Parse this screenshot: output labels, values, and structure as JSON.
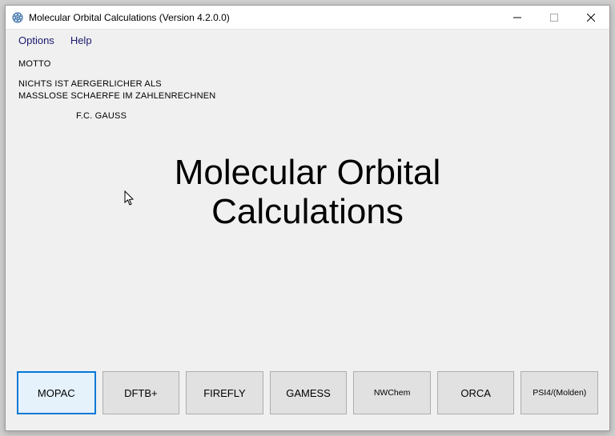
{
  "window": {
    "title": "Molecular Orbital Calculations (Version 4.2.0.0)"
  },
  "menu": {
    "options": "Options",
    "help": "Help"
  },
  "motto": {
    "label": "MOTTO",
    "line1": "NICHTS IST AERGERLICHER ALS",
    "line2": "MASSLOSE SCHAERFE IM ZAHLENRECHNEN",
    "author": "F.C. GAUSS"
  },
  "main_title": {
    "line1": "Molecular Orbital",
    "line2": "Calculations"
  },
  "engines": {
    "mopac": "MOPAC",
    "dftb": "DFTB+",
    "firefly": "FIREFLY",
    "gamess": "GAMESS",
    "nwchem": "NWChem",
    "orca": "ORCA",
    "psi4": "PSI4/(Molden)"
  }
}
